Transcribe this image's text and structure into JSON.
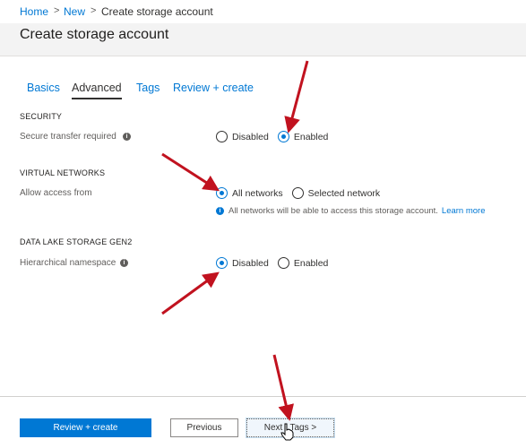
{
  "breadcrumb": {
    "home": "Home",
    "new": "New",
    "current": "Create storage account"
  },
  "page_title": "Create storage account",
  "tabs": [
    {
      "label": "Basics",
      "active": false
    },
    {
      "label": "Advanced",
      "active": true
    },
    {
      "label": "Tags",
      "active": false
    },
    {
      "label": "Review + create",
      "active": false
    }
  ],
  "sections": {
    "security": {
      "header": "SECURITY",
      "field_label": "Secure transfer required",
      "options": [
        "Disabled",
        "Enabled"
      ],
      "selected": "Enabled"
    },
    "virtual_networks": {
      "header": "VIRTUAL NETWORKS",
      "field_label": "Allow access from",
      "options": [
        "All networks",
        "Selected network"
      ],
      "selected": "All networks",
      "note": "All networks will be able to access this storage account.",
      "note_link": "Learn more"
    },
    "data_lake": {
      "header": "DATA LAKE STORAGE GEN2",
      "field_label": "Hierarchical namespace",
      "options": [
        "Disabled",
        "Enabled"
      ],
      "selected": "Disabled"
    }
  },
  "footer": {
    "review_create": "Review + create",
    "previous": "Previous",
    "next": "Next : Tags >"
  },
  "colors": {
    "accent": "#0078d4",
    "annotation_arrow": "#c1121f"
  },
  "icons": {
    "info": "info-icon",
    "breadcrumb_separator": "chevron-right-icon",
    "cursor": "hand-pointer-icon"
  }
}
